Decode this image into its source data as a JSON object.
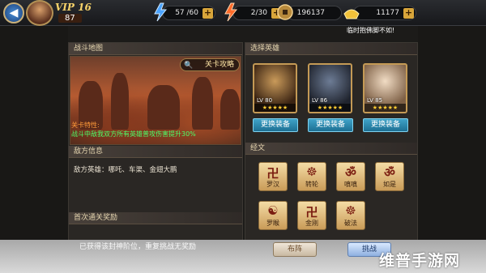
{
  "topbar": {
    "vip": "VIP 16",
    "level": "87",
    "stamina": "57 /60",
    "energy": "2/30",
    "coins": "196137",
    "gold": "11177",
    "notice": "临时抱佛脚不如!"
  },
  "battle_map": {
    "title": "战斗地图",
    "guide": "关卡攻略",
    "trait_label": "关卡特性:",
    "trait_text": "战斗中敌我双方所有英雄普攻伤害提升30%"
  },
  "enemy": {
    "title": "敌方信息",
    "text": "敌方英雄：哪吒、车渠、金翅大鹏"
  },
  "reward": {
    "title": "首次通关奖励",
    "message": "已获得该封神阶位，重复挑战无奖励"
  },
  "heroes": {
    "title": "选择英雄",
    "list": [
      {
        "level": "LV 80",
        "stars": "★★★★★",
        "equip": "更换装备"
      },
      {
        "level": "LV 86",
        "stars": "★★★★★",
        "equip": "更换装备"
      },
      {
        "level": "LV 85",
        "stars": "★★★★★",
        "equip": "更换装备"
      }
    ]
  },
  "scriptures": {
    "title": "经文",
    "items": [
      "罗汉",
      "转轮",
      "嗔嗔",
      "如是",
      "罗睺",
      "金刚",
      "破法"
    ]
  },
  "actions": {
    "formation": "布阵",
    "fight": "挑战"
  },
  "watermark": "维普手游网",
  "colors": {
    "accent_gold": "#f7d36a",
    "equip_blue": "#1d6f93",
    "trait_orange": "#ff9b3a",
    "trait_green": "#4cff6a"
  }
}
